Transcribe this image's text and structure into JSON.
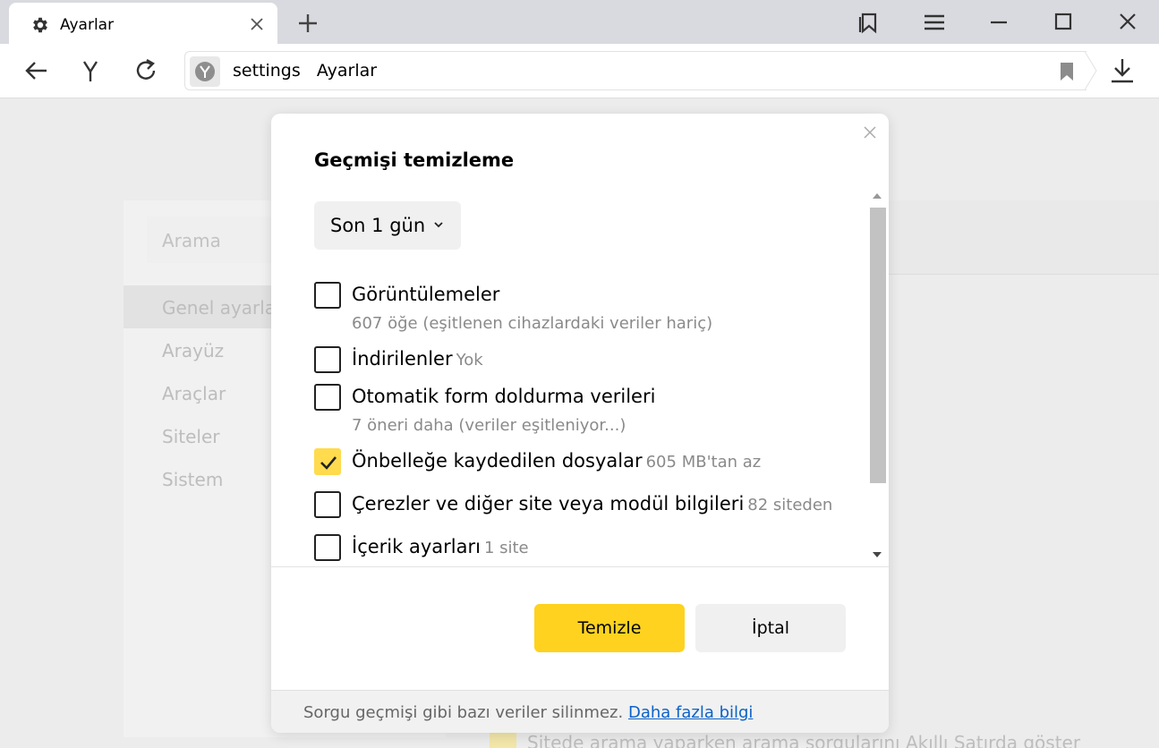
{
  "tab": {
    "title": "Ayarlar",
    "icon": "gear-icon"
  },
  "window_controls": [
    "bookmarks-panel-icon",
    "menu-icon",
    "minimize-icon",
    "maximize-icon",
    "close-icon"
  ],
  "toolbar": {
    "address_prefix": "settings",
    "address_title": "Ayarlar"
  },
  "background_page": {
    "search_placeholder": "Arama",
    "nav": [
      "Genel ayarlar",
      "Arayüz",
      "Araçlar",
      "Siteler",
      "Sistem"
    ],
    "bottom_text": "Sitede arama yaparken arama sorgularını Akıllı Satırda göster"
  },
  "dialog": {
    "title": "Geçmişi temizleme",
    "period": "Son 1 gün",
    "options": [
      {
        "label": "Görüntülemeler",
        "meta": "",
        "sub": "607 öğe (eşitlenen cihazlardaki veriler hariç)",
        "checked": false
      },
      {
        "label": "İndirilenler",
        "meta": "Yok",
        "sub": "",
        "checked": false
      },
      {
        "label": "Otomatik form doldurma verileri",
        "meta": "",
        "sub": "7 öneri daha (veriler eşitleniyor...)",
        "checked": false
      },
      {
        "label": "Önbelleğe kaydedilen dosyalar",
        "meta": "605 MB'tan az",
        "sub": "",
        "checked": true
      },
      {
        "label": "Çerezler ve diğer site veya modül bilgileri",
        "meta": "82 siteden",
        "sub": "",
        "checked": false
      },
      {
        "label": "İçerik ayarları",
        "meta": "1 site",
        "sub": "",
        "checked": false
      }
    ],
    "clear_button": "Temizle",
    "cancel_button": "İptal",
    "footer_text": "Sorgu geçmişi gibi bazı veriler silinmez.",
    "footer_link": "Daha fazla bilgi"
  },
  "colors": {
    "accent": "#ffd21f",
    "link": "#0b62c9"
  }
}
